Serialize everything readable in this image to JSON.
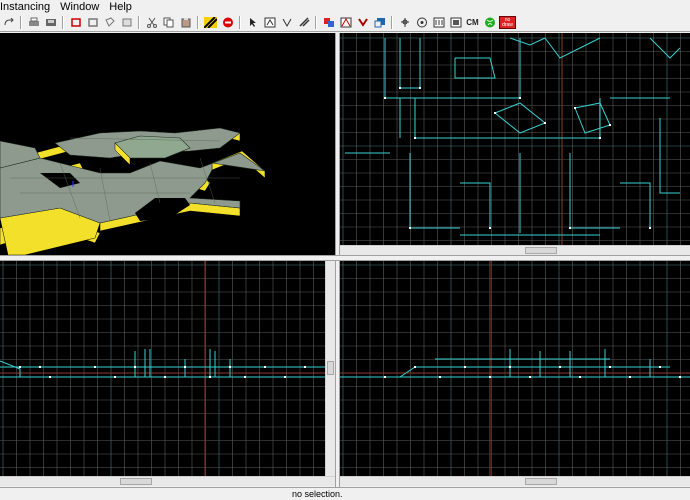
{
  "menu": [
    "Instancing",
    "Window",
    "Help"
  ],
  "toolbar": {
    "cm_label": "CM",
    "no_draw_label": "no draw"
  },
  "status": {
    "text": "no selection."
  },
  "colors": {
    "grid": "#5a5a5a",
    "grid_major": "#4a7a7a",
    "axis": "#8a3a2a",
    "brush": "#3ad0d0",
    "brush_face": "#8e9a8e",
    "brush_side": "#f2e02a"
  }
}
